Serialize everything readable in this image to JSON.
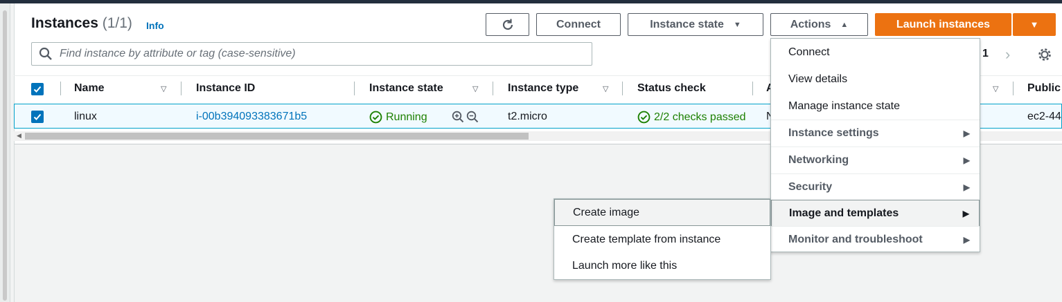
{
  "header": {
    "title": "Instances",
    "count": "(1/1)",
    "info": "Info"
  },
  "toolbar": {
    "refresh_icon": "refresh-icon",
    "connect": "Connect",
    "instance_state": "Instance state",
    "actions": "Actions",
    "launch": "Launch instances"
  },
  "search": {
    "placeholder": "Find instance by attribute or tag (case-sensitive)"
  },
  "pagination": {
    "page": "1"
  },
  "table": {
    "columns": [
      "Name",
      "Instance ID",
      "Instance state",
      "Instance type",
      "Status check",
      "A",
      "Public"
    ],
    "rows": [
      {
        "name": "linux",
        "instance_id": "i-00b394093383671b5",
        "state": "Running",
        "type": "t2.micro",
        "status": "2/2 checks passed",
        "col6": "N",
        "public": "ec2-44"
      }
    ]
  },
  "actions_menu": {
    "items": [
      {
        "label": "Connect",
        "group": false
      },
      {
        "label": "View details",
        "group": false
      },
      {
        "label": "Manage instance state",
        "group": false
      },
      {
        "label": "Instance settings",
        "group": true
      },
      {
        "label": "Networking",
        "group": true
      },
      {
        "label": "Security",
        "group": true
      },
      {
        "label": "Image and templates",
        "group": true,
        "active": true
      },
      {
        "label": "Monitor and troubleshoot",
        "group": true
      }
    ]
  },
  "submenu": {
    "items": [
      "Create image",
      "Create template from instance",
      "Launch more like this"
    ]
  },
  "colors": {
    "accent": "#ec7211",
    "link": "#0073bb",
    "success": "#1d8102",
    "selected_row": "#f1faff"
  }
}
